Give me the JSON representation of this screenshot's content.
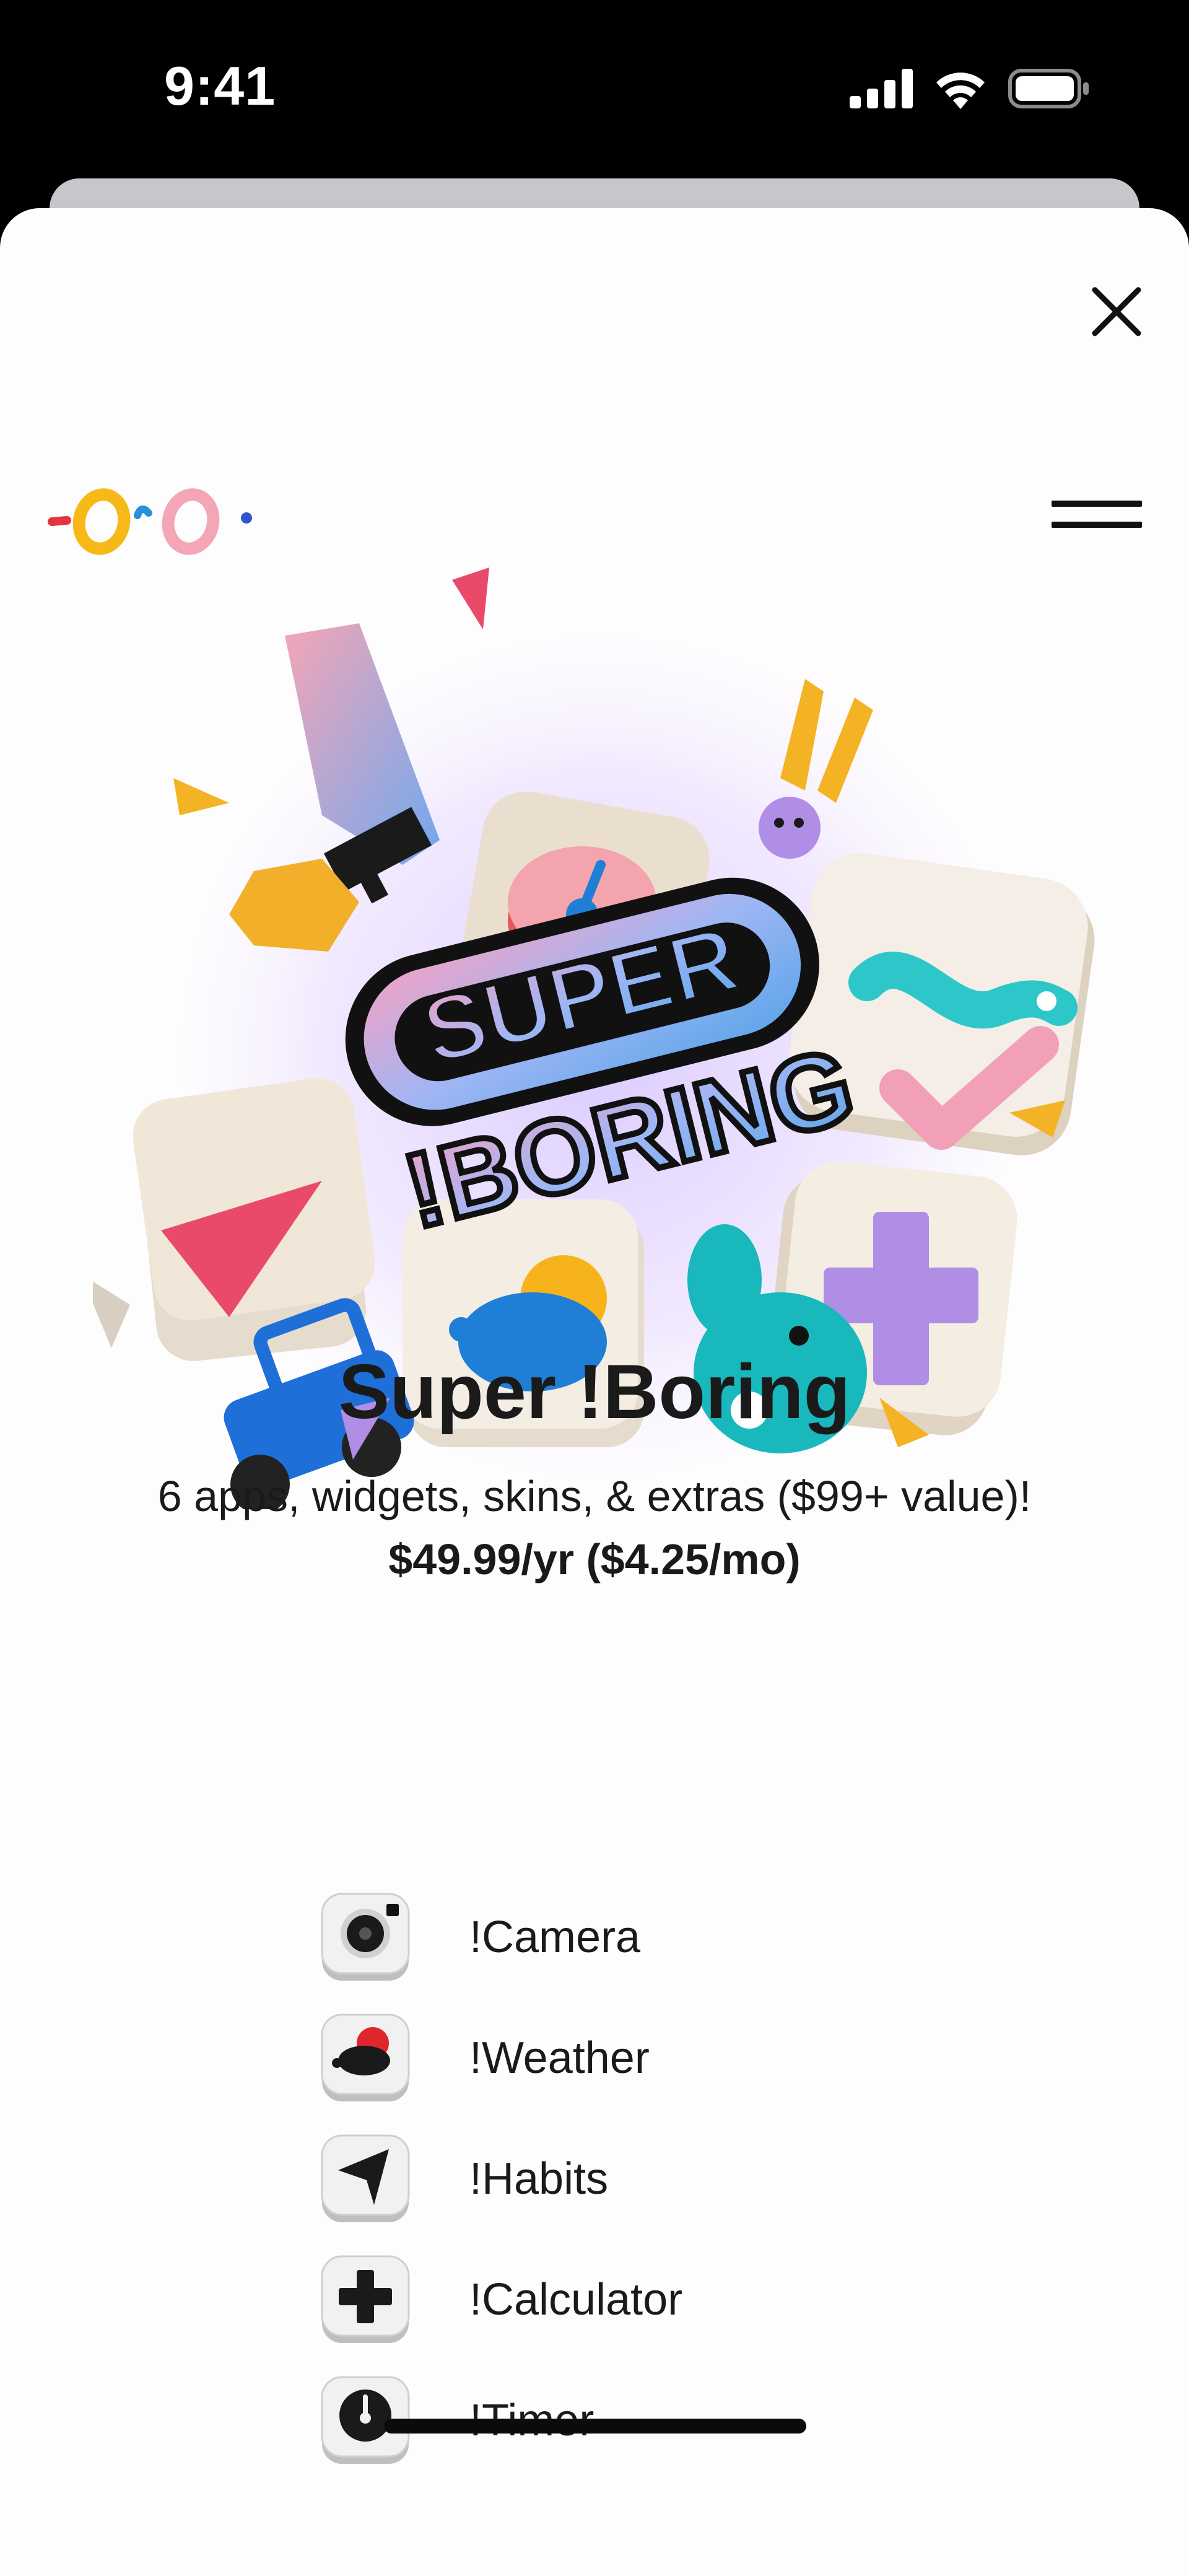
{
  "status_bar": {
    "time": "9:41",
    "icons": [
      "cellular-signal-icon",
      "wifi-icon",
      "battery-icon"
    ]
  },
  "sheet": {
    "close_icon": "close-icon",
    "menu_icon": "hamburger-menu-icon",
    "logo_icon": "super-boring-logo-icon"
  },
  "hero": {
    "wordmark_line1": "SUPER",
    "wordmark_line2": "!BORING"
  },
  "product": {
    "title": "Super !Boring",
    "subtitle": "6 apps, widgets, skins, & extras ($99+ value)!",
    "price": "$49.99/yr ($4.25/mo)"
  },
  "apps": [
    {
      "label": "!Camera",
      "icon": "camera-icon"
    },
    {
      "label": "!Weather",
      "icon": "weather-icon"
    },
    {
      "label": "!Habits",
      "icon": "habits-icon"
    },
    {
      "label": "!Calculator",
      "icon": "calculator-icon"
    },
    {
      "label": "!Timer",
      "icon": "timer-icon"
    }
  ],
  "colors": {
    "background": "#fefdfe",
    "text": "#1a1a1a",
    "status_bar": "#000000",
    "logo_red": "#e3343f",
    "logo_yellow": "#f7b917",
    "logo_pink": "#f4a6b6",
    "logo_blue": "#2f56c8"
  }
}
